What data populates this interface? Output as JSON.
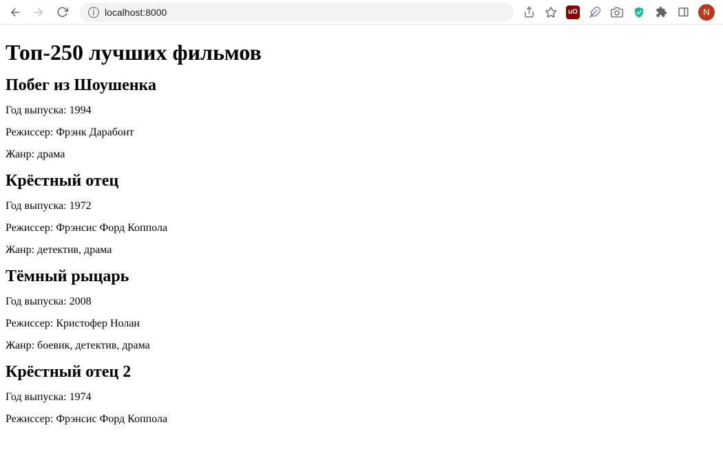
{
  "browser": {
    "url": "localhost:8000",
    "profile_initial": "N",
    "ublock_label": "uO"
  },
  "page": {
    "title": "Топ-250 лучших фильмов",
    "labels": {
      "year": "Год выпуска:",
      "director": "Режиссер:",
      "genre": "Жанр:"
    },
    "movies": [
      {
        "title": "Побег из Шоушенка",
        "year": "1994",
        "director": "Фрэнк Дарабонт",
        "genre": "драма"
      },
      {
        "title": "Крёстный отец",
        "year": "1972",
        "director": "Фрэнсис Форд Коппола",
        "genre": "детектив, драма"
      },
      {
        "title": "Тёмный рыцарь",
        "year": "2008",
        "director": "Кристофер Нолан",
        "genre": "боевик, детектив, драма"
      },
      {
        "title": "Крёстный отец 2",
        "year": "1974",
        "director": "Фрэнсис Форд Коппола",
        "genre": ""
      }
    ]
  }
}
